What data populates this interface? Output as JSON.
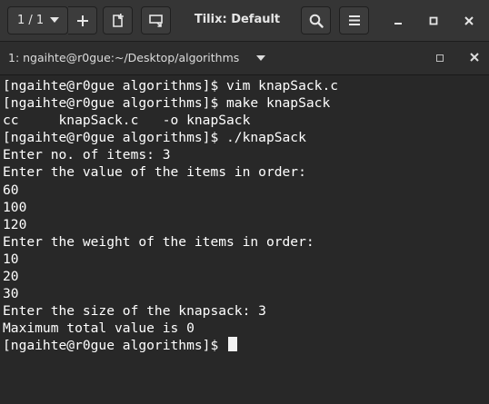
{
  "headerbar": {
    "session_switcher": "1 / 1",
    "title": "Tilix: Default",
    "icons": [
      "chevron-down-icon",
      "add-icon",
      "add-session-icon",
      "sync-input-icon",
      "search-icon",
      "hamburger-menu-icon",
      "minimize-icon",
      "maximize-icon",
      "close-icon"
    ]
  },
  "tab": {
    "label": "1: ngaihte@r0gue:~/Desktop/algorithms",
    "icons": [
      "chevron-down-icon",
      "maximize-icon",
      "close-icon"
    ]
  },
  "terminal": {
    "lines": [
      "[ngaihte@r0gue algorithms]$ vim knapSack.c",
      "[ngaihte@r0gue algorithms]$ make knapSack",
      "cc     knapSack.c   -o knapSack",
      "[ngaihte@r0gue algorithms]$ ./knapSack",
      "Enter no. of items: 3",
      "Enter the value of the items in order:",
      "60",
      "100",
      "120",
      "Enter the weight of the items in order:",
      "10",
      "20",
      "30",
      "Enter the size of the knapsack: 3",
      "Maximum total value is 0"
    ],
    "prompt": "[ngaihte@r0gue algorithms]$ "
  },
  "colors": {
    "terminal_bg": "#282828",
    "terminal_fg": "#ffffff",
    "headerbar_bg": "#353535"
  }
}
